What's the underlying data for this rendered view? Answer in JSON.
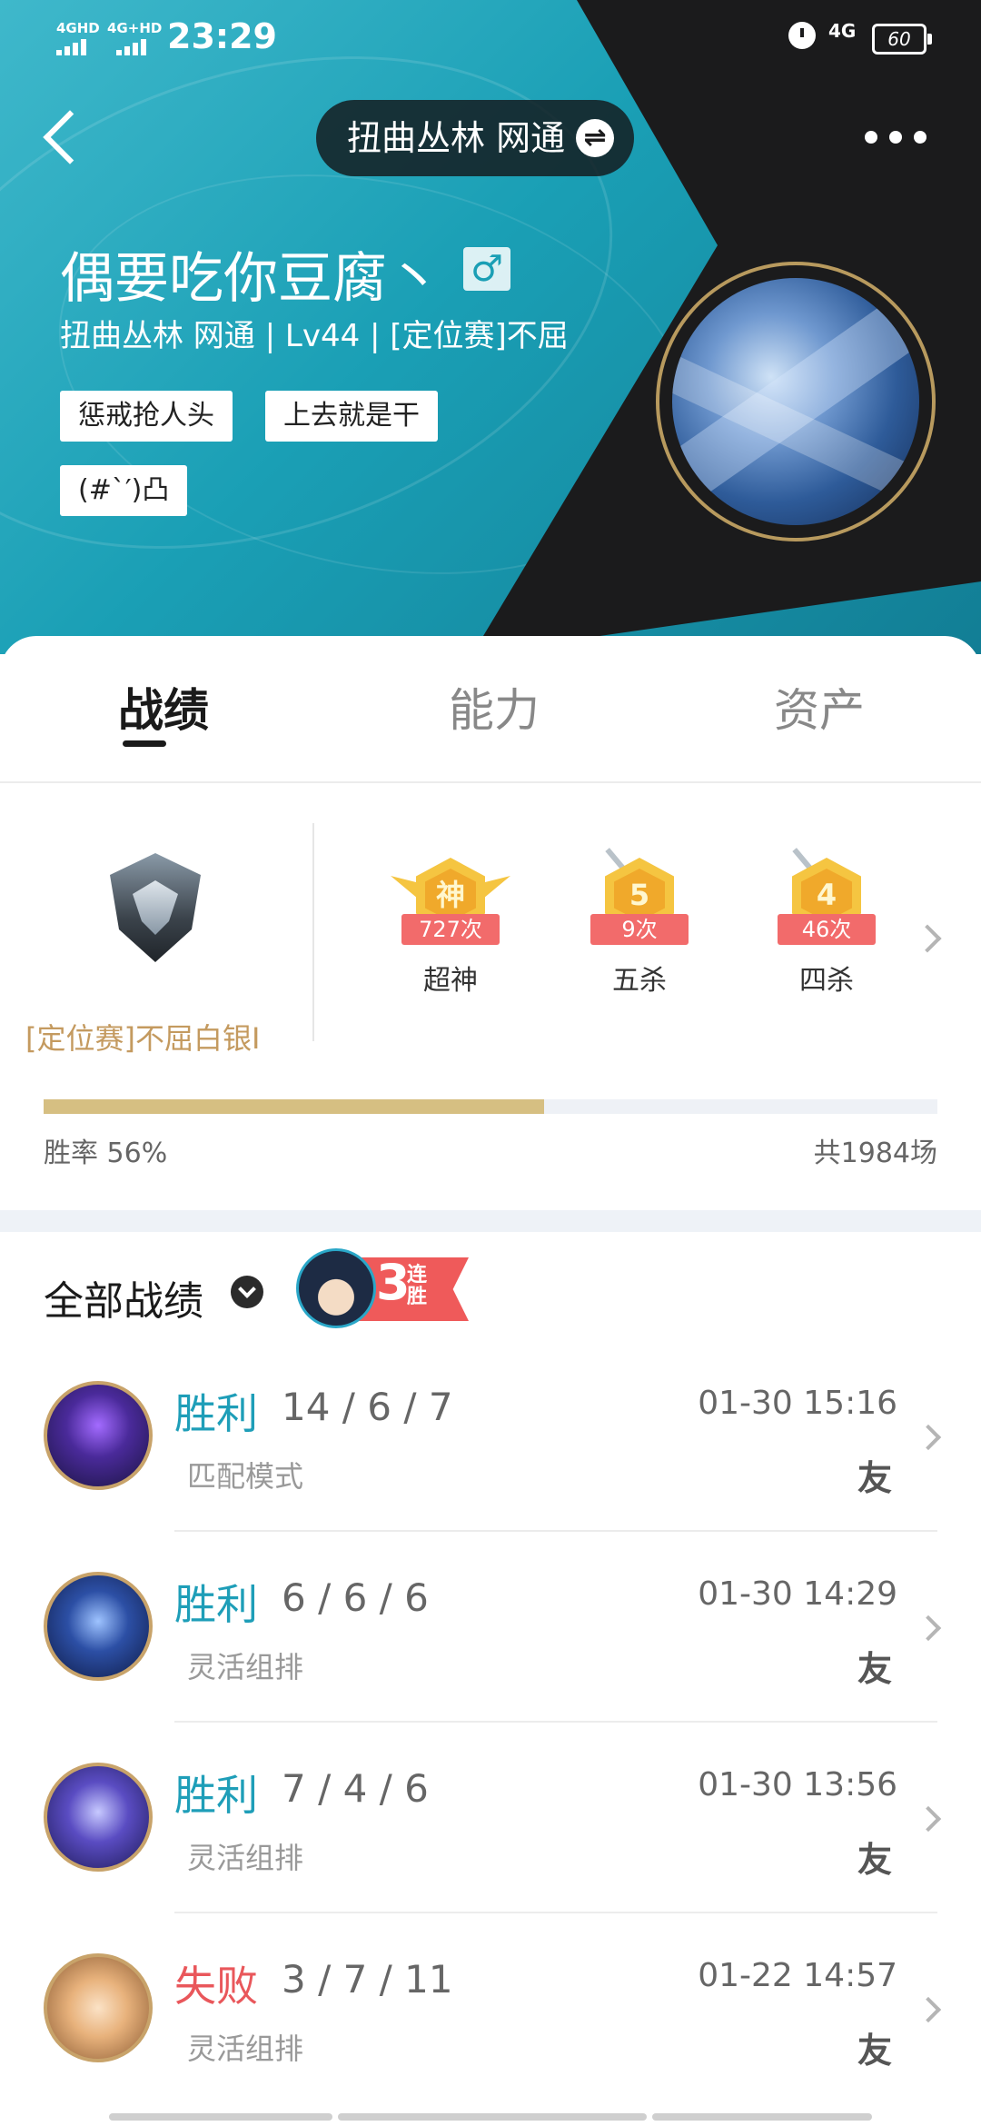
{
  "status_bar": {
    "signal1": "4GHD",
    "signal2": "4G+HD",
    "time": "23:29",
    "network": "4G",
    "battery": "60"
  },
  "header": {
    "server": "扭曲丛林 网通",
    "switch_symbol": "⇌",
    "player_name": "偶要吃你豆腐丶",
    "gender_symbol": "♂",
    "player_info": "扭曲丛林 网通 | Lv44 | [定位赛]不屈",
    "tags": [
      "惩戒抢人头",
      "上去就是干",
      "(#`′)凸"
    ]
  },
  "tabs": [
    "战绩",
    "能力",
    "资产"
  ],
  "stats": {
    "rank": "[定位赛]不屈白银I",
    "badges": [
      {
        "icon": "神",
        "count": "727次",
        "label": "超神"
      },
      {
        "icon": "5",
        "count": "9次",
        "label": "五杀"
      },
      {
        "icon": "4",
        "count": "46次",
        "label": "四杀"
      }
    ],
    "win_rate_label": "胜率  56%",
    "win_rate": 0.56,
    "total_label": "共1984场"
  },
  "records": {
    "title": "全部战绩",
    "streak_num": "3",
    "streak_text": "连胜",
    "items": [
      {
        "result": "胜利",
        "kda": "14 / 6 / 7",
        "mode": "匹配模式",
        "time": "01-30 15:16",
        "friend": "友"
      },
      {
        "result": "胜利",
        "kda": "6 / 6 / 6",
        "mode": "灵活组排",
        "time": "01-30 14:29",
        "friend": "友"
      },
      {
        "result": "胜利",
        "kda": "7 / 4 / 6",
        "mode": "灵活组排",
        "time": "01-30 13:56",
        "friend": "友"
      },
      {
        "result": "失败",
        "kda": "3 / 7 / 11",
        "mode": "灵活组排",
        "time": "01-22 14:57",
        "friend": "友"
      }
    ]
  },
  "colors": {
    "accent_win": "#1e9eb8",
    "accent_loss": "#e9575b",
    "rank_gold": "#c49a5f",
    "winbar_fill": "#d6bf82"
  }
}
